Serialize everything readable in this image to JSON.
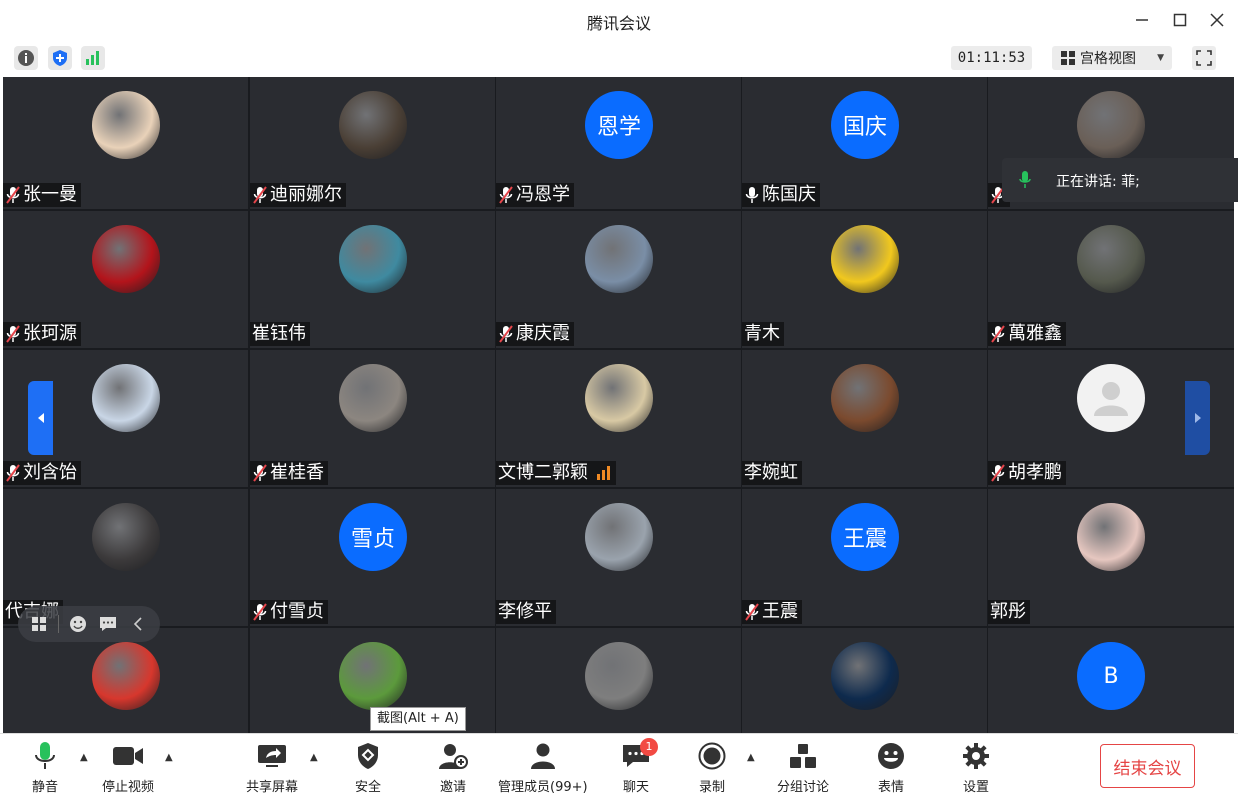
{
  "window": {
    "title": "腾讯会议"
  },
  "statusbar": {
    "timer": "01:11:53",
    "view_label": "宫格视图"
  },
  "speaking": {
    "text": "正在讲话: 菲;"
  },
  "tooltip": {
    "text": "截图(Alt + A)"
  },
  "participants": [
    {
      "name": "张一曼",
      "muted": true,
      "avatar": "photo",
      "avatar_color": "#e9d2b9"
    },
    {
      "name": "迪丽娜尔",
      "muted": true,
      "avatar": "photo",
      "avatar_color": "#4a3f35"
    },
    {
      "name": "冯恩学",
      "muted": true,
      "avatar": "text",
      "avatar_text": "恩学"
    },
    {
      "name": "陈国庆",
      "muted": false,
      "avatar": "text",
      "avatar_text": "国庆"
    },
    {
      "name": "",
      "muted": true,
      "avatar": "photo",
      "avatar_color": "#6a5f57"
    },
    {
      "name": "张珂源",
      "muted": true,
      "avatar": "photo",
      "avatar_color": "#b3141b"
    },
    {
      "name": "崔钰伟",
      "muted": null,
      "avatar": "photo",
      "avatar_color": "#3f8aa0"
    },
    {
      "name": "康庆霞",
      "muted": true,
      "avatar": "photo",
      "avatar_color": "#7a8ea6"
    },
    {
      "name": "青木",
      "muted": null,
      "avatar": "photo",
      "avatar_color": "#f1c81e"
    },
    {
      "name": "萬雅鑫",
      "muted": true,
      "avatar": "photo",
      "avatar_color": "#55594d"
    },
    {
      "name": "刘含饴",
      "muted": true,
      "avatar": "photo",
      "avatar_color": "#c9d6e6"
    },
    {
      "name": "崔桂香",
      "muted": true,
      "avatar": "photo",
      "avatar_color": "#8c8680"
    },
    {
      "name": "文博二郭颖",
      "muted": null,
      "signal": true,
      "avatar": "photo",
      "avatar_color": "#d8c9a4"
    },
    {
      "name": "李婉虹",
      "muted": null,
      "avatar": "photo",
      "avatar_color": "#7b4a2e"
    },
    {
      "name": "胡孝鹏",
      "muted": true,
      "avatar": "grey"
    },
    {
      "name": "代吉娜",
      "muted": null,
      "avatar": "photo",
      "avatar_color": "#3c3a3b"
    },
    {
      "name": "付雪贞",
      "muted": true,
      "avatar": "text",
      "avatar_text": "雪贞"
    },
    {
      "name": "李修平",
      "muted": null,
      "avatar": "photo",
      "avatar_color": "#9aa3ad"
    },
    {
      "name": "王震",
      "muted": true,
      "avatar": "text",
      "avatar_text": "王震"
    },
    {
      "name": "郭彤",
      "muted": null,
      "avatar": "photo",
      "avatar_color": "#e6c7c0"
    },
    {
      "name": "",
      "muted": null,
      "avatar": "photo",
      "avatar_color": "#d7372d"
    },
    {
      "name": "",
      "muted": null,
      "avatar": "photo",
      "avatar_color": "#5c9a3c"
    },
    {
      "name": "",
      "muted": null,
      "avatar": "photo",
      "avatar_color": "#7e7e7e"
    },
    {
      "name": "",
      "muted": null,
      "avatar": "photo",
      "avatar_color": "#0e2a4d"
    },
    {
      "name": "",
      "muted": null,
      "avatar": "text",
      "avatar_text": "B"
    }
  ],
  "toolbar": {
    "mute": "静音",
    "stop_video": "停止视频",
    "share_screen": "共享屏幕",
    "security": "安全",
    "invite": "邀请",
    "manage_members": "管理成员(99+)",
    "chat": "聊天",
    "chat_badge": "1",
    "record": "录制",
    "breakout": "分组讨论",
    "reactions": "表情",
    "settings": "设置",
    "end_meeting": "结束会议"
  },
  "colors": {
    "accent": "#0a6cff",
    "end_red": "#e54545",
    "mic_green": "#27c15c",
    "grid_bg": "#2a2c31"
  }
}
